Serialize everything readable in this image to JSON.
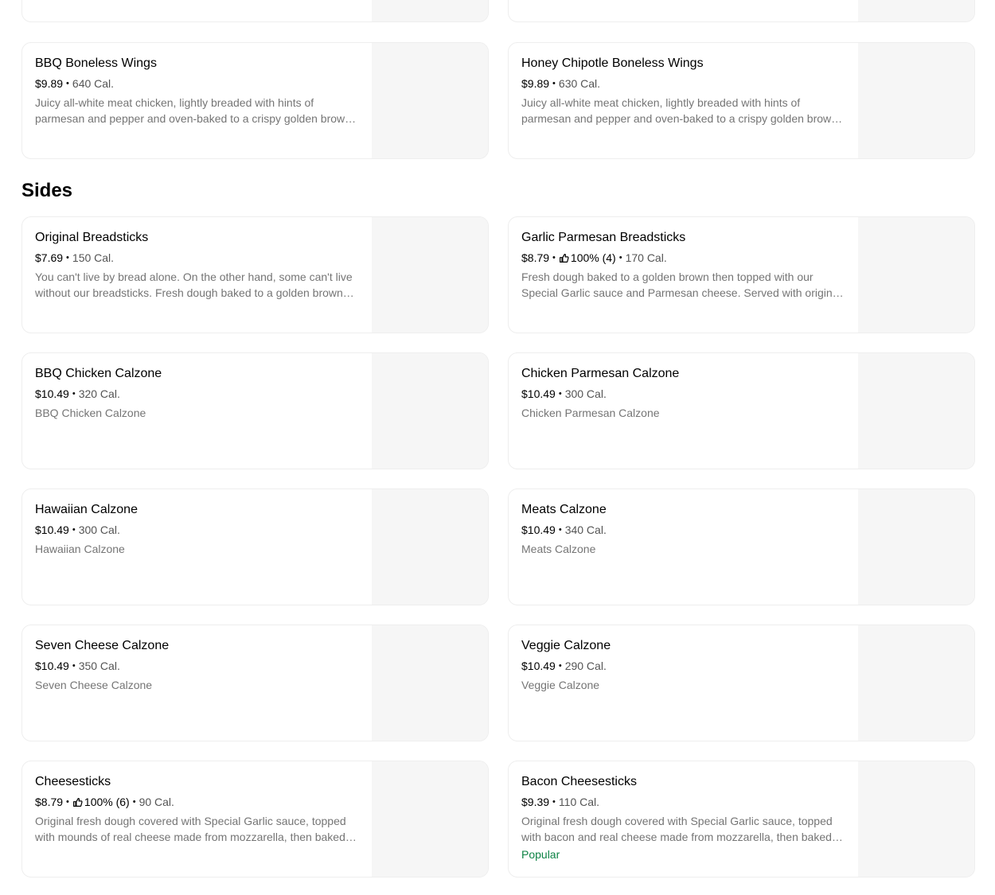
{
  "wings": {
    "items": [
      {
        "name": "BBQ Boneless Wings",
        "price": "$9.89",
        "calories": "640 Cal.",
        "description": "Juicy all-white meat chicken, lightly breaded with hints of parmesan and pepper and oven-baked to a crispy golden brown, then tossed in your choice of sauce."
      },
      {
        "name": "Honey Chipotle Boneless Wings",
        "price": "$9.89",
        "calories": "630 Cal.",
        "description": "Juicy all-white meat chicken, lightly breaded with hints of parmesan and pepper and oven-baked to a crispy golden brown, then tossed in your choice of sauce."
      }
    ]
  },
  "sides": {
    "title": "Sides",
    "items": [
      {
        "name": "Original Breadsticks",
        "price": "$7.69",
        "calories": "150 Cal.",
        "description": "You can't live by bread alone. On the other hand, some can't live without our breadsticks. Fresh dough baked to a golden brown and topped with Special Garlic sauce."
      },
      {
        "name": "Garlic Parmesan Breadsticks",
        "price": "$8.79",
        "rating": "100% (4)",
        "calories": "170 Cal.",
        "description": "Fresh dough baked to a golden brown then topped with our Special Garlic sauce and Parmesan cheese. Served with original marinara sauce."
      },
      {
        "name": "BBQ Chicken Calzone",
        "price": "$10.49",
        "calories": "320 Cal.",
        "description": "BBQ Chicken Calzone"
      },
      {
        "name": "Chicken Parmesan Calzone",
        "price": "$10.49",
        "calories": "300 Cal.",
        "description": "Chicken Parmesan Calzone"
      },
      {
        "name": "Hawaiian Calzone",
        "price": "$10.49",
        "calories": "300 Cal.",
        "description": "Hawaiian Calzone"
      },
      {
        "name": "Meats Calzone",
        "price": "$10.49",
        "calories": "340 Cal.",
        "description": "Meats Calzone"
      },
      {
        "name": "Seven Cheese Calzone",
        "price": "$10.49",
        "calories": "350 Cal.",
        "description": "Seven Cheese Calzone"
      },
      {
        "name": "Veggie Calzone",
        "price": "$10.49",
        "calories": "290 Cal.",
        "description": "Veggie Calzone"
      },
      {
        "name": "Cheesesticks",
        "price": "$8.79",
        "rating": "100% (6)",
        "calories": "90 Cal.",
        "description": "Original fresh dough covered with Special Garlic sauce, topped with mounds of real cheese made from mozzarella, then baked to a golden brown."
      },
      {
        "name": "Bacon Cheesesticks",
        "price": "$9.39",
        "calories": "110 Cal.",
        "description": "Original fresh dough covered with Special Garlic sauce, topped with bacon and real cheese made from mozzarella, then baked to a golden brown.",
        "badge": "Popular"
      }
    ]
  },
  "colors": {
    "popular_badge": "#0e8345",
    "card_border": "#eeeeee",
    "thumbnail_placeholder": "#f6f6f6"
  },
  "icons": {
    "rating": "thumbs-up-icon"
  }
}
